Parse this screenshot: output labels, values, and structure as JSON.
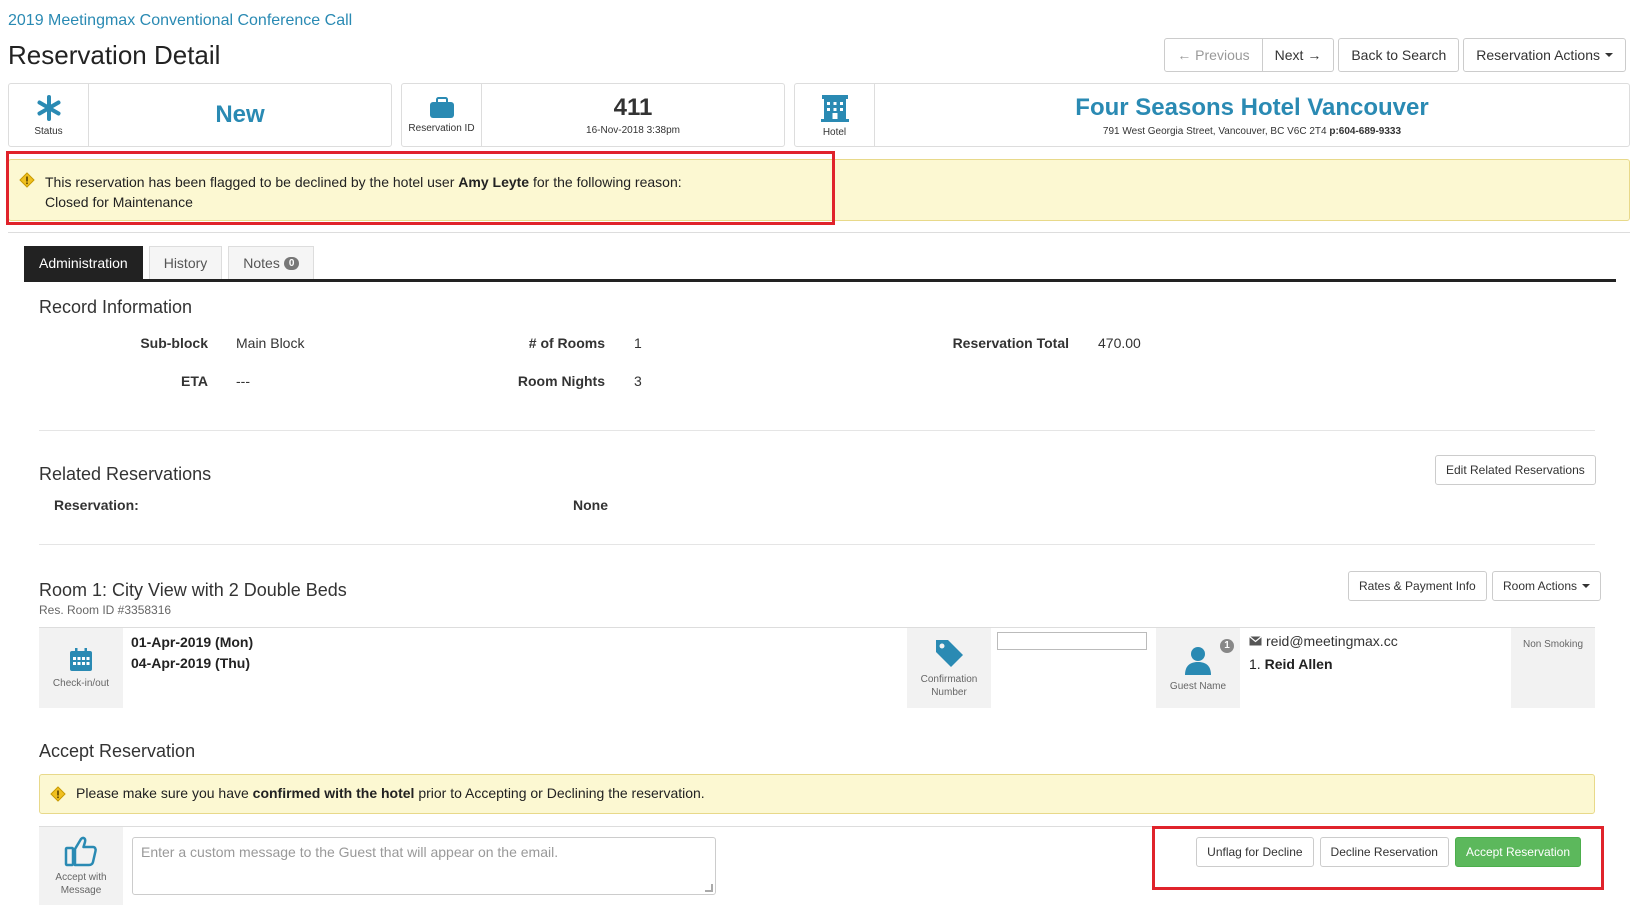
{
  "header": {
    "event_link": "2019 Meetingmax Conventional Conference Call",
    "page_title": "Reservation Detail",
    "previous_label": "← Previous",
    "next_label": "Next →",
    "back_label": "Back to Search",
    "actions_label": "Reservation Actions"
  },
  "summary": {
    "status_caption": "Status",
    "status_value": "New",
    "resid_caption": "Reservation ID",
    "resid_value": "411",
    "resid_date": "16-Nov-2018 3:38pm",
    "hotel_caption": "Hotel",
    "hotel_name": "Four Seasons Hotel Vancouver",
    "hotel_address": "791 West Georgia Street, Vancouver, BC V6C 2T4",
    "hotel_phone": "p:604-689-9333"
  },
  "flag_alert": {
    "text_before": "This reservation has been flagged to be declined by the hotel user ",
    "user": "Amy Leyte",
    "text_after": " for the following reason:",
    "reason": "Closed for Maintenance"
  },
  "tabs": [
    {
      "label": "Administration",
      "active": true
    },
    {
      "label": "History",
      "active": false
    },
    {
      "label": "Notes",
      "badge": "0",
      "active": false
    }
  ],
  "record_info": {
    "title": "Record Information",
    "subblock_label": "Sub-block",
    "subblock_value": "Main Block",
    "eta_label": "ETA",
    "eta_value": "---",
    "rooms_label": "# of Rooms",
    "rooms_value": "1",
    "nights_label": "Room Nights",
    "nights_value": "3",
    "total_label": "Reservation Total",
    "total_value": "470.00"
  },
  "related": {
    "title": "Related Reservations",
    "edit_label": "Edit Related Reservations",
    "reservation_label": "Reservation:",
    "reservation_value": "None"
  },
  "room": {
    "title": "Room 1: City View with 2 Double Beds",
    "room_id": "Res. Room ID #3358316",
    "rates_label": "Rates & Payment Info",
    "actions_label": "Room Actions",
    "checkin_caption": "Check-in/out",
    "checkin": "01-Apr-2019 (Mon)",
    "checkout": "04-Apr-2019 (Thu)",
    "confirmation_caption_1": "Confirmation",
    "confirmation_caption_2": "Number",
    "confirmation_value": "",
    "guest_caption": "Guest Name",
    "guest_count": "1",
    "email": "reid@meetingmax.cc",
    "guest_index": "1.",
    "guest_name": "Reid Allen",
    "smoking": "Non Smoking"
  },
  "accept": {
    "title": "Accept Reservation",
    "alert_before": "Please make sure you have ",
    "alert_bold": "confirmed with the hotel",
    "alert_after": " prior to Accepting or Declining the reservation.",
    "icon_caption_1": "Accept with",
    "icon_caption_2": "Message",
    "message_placeholder": "Enter a custom message to the Guest that will appear on the email.",
    "unflag_label": "Unflag for Decline",
    "decline_label": "Decline Reservation",
    "accept_label": "Accept Reservation"
  },
  "colors": {
    "brand": "#2a8ab3",
    "alert_bg": "#fcf8d2",
    "highlight": "#e0232b",
    "success": "#5cb85c"
  }
}
